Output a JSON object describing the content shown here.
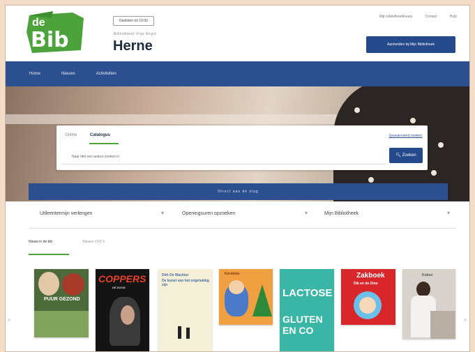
{
  "header": {
    "logo_text_top": "de",
    "logo_text_main": "Bib",
    "status_pill": "Gesloten tot 15:00",
    "library_name": "Bibliotheek Vrije Regio",
    "town": "Herne",
    "top_links": [
      "Mijn bibliotheekkeuze",
      "Contact",
      "Hulp"
    ],
    "login_button": "Aanmelden bij Mijn Bibliotheek"
  },
  "nav": {
    "items": [
      "Home",
      "Nieuws",
      "Activiteiten"
    ]
  },
  "search": {
    "tabs": [
      "Online",
      "Catalogus"
    ],
    "advanced_link": "Geavanceerd zoeken",
    "placeholder": "Naar titel een auteur zoeken in",
    "button": "Zoeken"
  },
  "cta_bar": "Direct aan de slag",
  "quick_links": [
    "Uitleentermijn verlengen",
    "Openingsuren opzoeken",
    "Mijn Bibliotheek"
  ],
  "section_tabs": [
    "Nieuw in de bib",
    "Nieuwe DVD's"
  ],
  "books": [
    {
      "title": "PUUR GEZOND",
      "bg": "#4d6b3a"
    },
    {
      "title": "COPPERS",
      "subtitle": "DE DOOD",
      "bg": "#141414"
    },
    {
      "title": "Dirk De Wachter",
      "subtitle": "De kunst van het ongelukkig zijn",
      "bg": "#f4f0d8"
    },
    {
      "title": "Kerstmis",
      "bg": "#f0a040"
    },
    {
      "title": "LACTOSE",
      "subtitle": "GLUTEN EN CO",
      "bg": "#39b6a6"
    },
    {
      "title": "Zakboek",
      "subtitle": "Dik en de Dino",
      "bg": "#d8262a"
    },
    {
      "title": "Koken",
      "bg": "#d8d2cc"
    }
  ],
  "colors": {
    "brand_green": "#4ca33b",
    "brand_blue": "#2c508f"
  }
}
